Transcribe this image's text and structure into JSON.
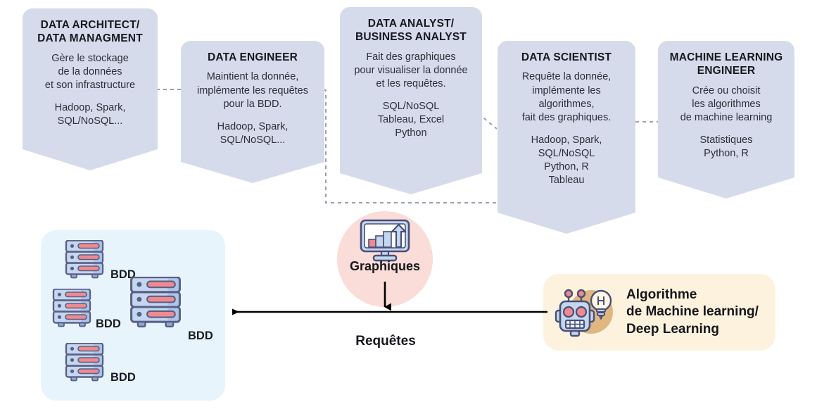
{
  "diagram": {
    "title": "Data roles and data flow diagram",
    "colors": {
      "card_fill": "#d6dbeb",
      "bdd_panel_fill": "#e8f4fc",
      "graphiques_circle_fill": "#fadcd8",
      "algo_box_fill": "#fdf2dd",
      "server_body": "#c3d7ef",
      "server_outline": "#5b5f86",
      "server_bar": "#f08a8f",
      "robot_blob": "#e0b681",
      "arrow_stroke": "#000000",
      "connector_stroke": "#9aa0ae",
      "text": "#16181d"
    }
  },
  "roles": [
    {
      "id": "data-architect",
      "title": "DATA ARCHITECT/\nDATA MANAGMENT",
      "description": "Gère le stockage\nde la données\net son infrastructure",
      "tools": "Hadoop, Spark,\nSQL/NoSQL..."
    },
    {
      "id": "data-engineer",
      "title": "DATA ENGINEER",
      "description": "Maintient la donnée,\nimplémente les requêtes\npour la BDD.",
      "tools": "Hadoop, Spark,\nSQL/NoSQL..."
    },
    {
      "id": "data-analyst",
      "title": "DATA ANALYST/\nBUSINESS ANALYST",
      "description": "Fait des graphiques\npour visualiser la donnée\net les requêtes.",
      "tools": "SQL/NoSQL\nTableau, Excel\nPython"
    },
    {
      "id": "data-scientist",
      "title": "DATA SCIENTIST",
      "description": "Requête la donnée,\nimplémente les\nalgorithmes,\nfait des graphiques.",
      "tools": "Hadoop, Spark,\nSQL/NoSQL\nPython, R\nTableau"
    },
    {
      "id": "machine-learning-engineer",
      "title": "MACHINE LEARNING\nENGINEER",
      "description": "Crée ou choisit\nles algorithmes\nde machine learning",
      "tools": "Statistiques\nPython, R"
    }
  ],
  "bdd": {
    "labels": [
      "BDD",
      "BDD",
      "BDD",
      "BDD"
    ]
  },
  "graphiques": {
    "label": "Graphiques",
    "icon": "monitor-bar-chart-icon"
  },
  "algorithme": {
    "label": "Algorithme\nde Machine learning/\nDeep Learning",
    "icons": [
      "robot-icon",
      "lightbulb-icon"
    ]
  },
  "flow": {
    "requetes_label": "Requêtes"
  }
}
